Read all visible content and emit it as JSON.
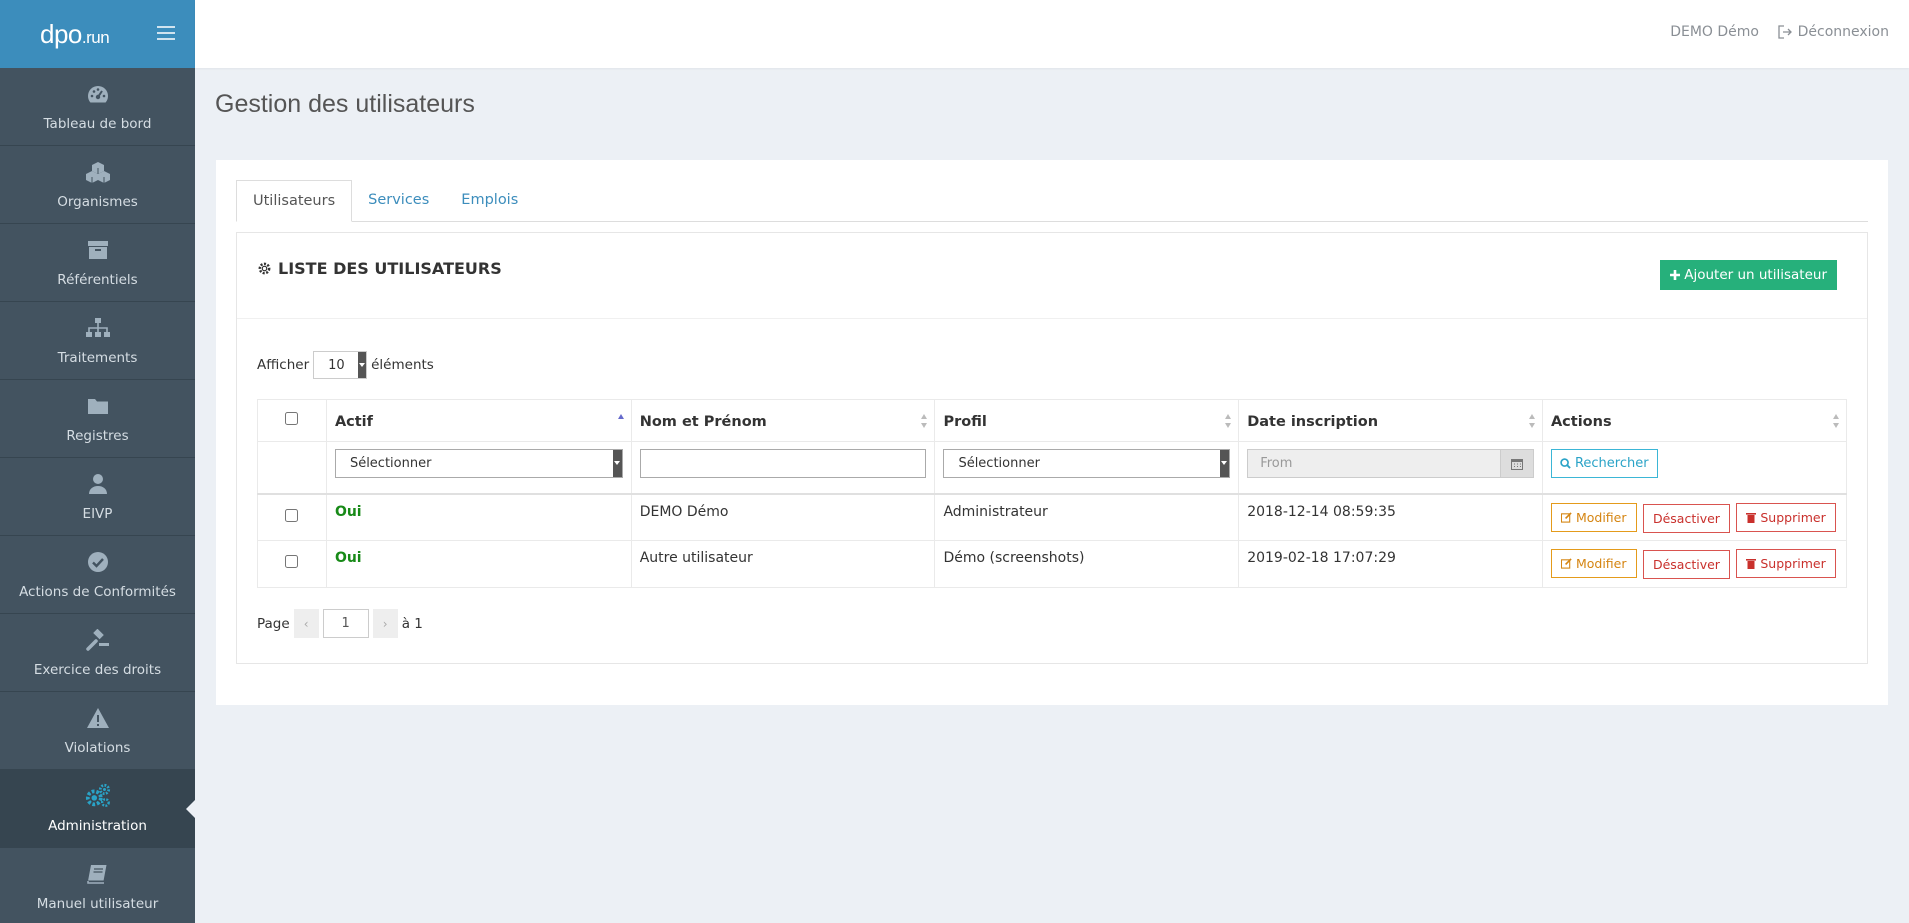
{
  "brand": {
    "logo_main": "dpo",
    "logo_suffix": ".run"
  },
  "sidebar": {
    "items": [
      {
        "label": "Tableau de bord",
        "icon": "dashboard-icon"
      },
      {
        "label": "Organismes",
        "icon": "cubes-icon"
      },
      {
        "label": "Référentiels",
        "icon": "archive-icon"
      },
      {
        "label": "Traitements",
        "icon": "sitemap-icon"
      },
      {
        "label": "Registres",
        "icon": "folder-icon"
      },
      {
        "label": "EIVP",
        "icon": "user-icon"
      },
      {
        "label": "Actions de Conformités",
        "icon": "check-circle-icon"
      },
      {
        "label": "Exercice des droits",
        "icon": "gavel-icon"
      },
      {
        "label": "Violations",
        "icon": "warning-icon"
      },
      {
        "label": "Administration",
        "icon": "cogs-icon",
        "active": true
      },
      {
        "label": "Manuel utilisateur",
        "icon": "book-icon"
      }
    ]
  },
  "header": {
    "user": "DEMO Démo",
    "logout": "Déconnexion"
  },
  "page": {
    "title": "Gestion des utilisateurs"
  },
  "tabs": [
    {
      "label": "Utilisateurs",
      "active": true
    },
    {
      "label": "Services"
    },
    {
      "label": "Emplois"
    }
  ],
  "panel": {
    "title": "LISTE DES UTILISATEURS",
    "add_button": "Ajouter un utilisateur"
  },
  "length": {
    "prefix": "Afficher",
    "value": "10",
    "suffix": "éléments"
  },
  "table": {
    "columns": [
      "Actif",
      "Nom et Prénom",
      "Profil",
      "Date inscription",
      "Actions"
    ],
    "filters": {
      "actif": "Sélectionner",
      "profil": "Sélectionner",
      "date_placeholder": "From",
      "search_button": "Rechercher"
    },
    "rows": [
      {
        "actif": "Oui",
        "nom": "DEMO Démo",
        "profil": "Administrateur",
        "date": "2018-12-14 08:59:35"
      },
      {
        "actif": "Oui",
        "nom": "Autre utilisateur",
        "profil": "Démo (screenshots)",
        "date": "2019-02-18 17:07:29"
      }
    ],
    "actions": {
      "edit": "Modifier",
      "deactivate": "Désactiver",
      "delete": "Supprimer"
    }
  },
  "pager": {
    "prefix": "Page",
    "prev": "‹",
    "current": "1",
    "next": "›",
    "suffix": "à 1"
  },
  "colors": {
    "sidebar": "#435360",
    "brand": "#3c8dbc",
    "success": "#26b07b",
    "warning": "#e49b1b",
    "danger": "#d9534f"
  }
}
